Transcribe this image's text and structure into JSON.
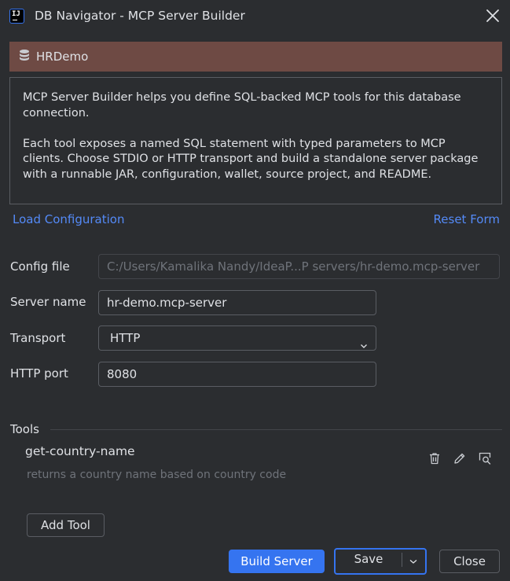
{
  "window": {
    "title": "DB Navigator - MCP Server Builder",
    "logo_text": "IJ"
  },
  "connection": {
    "name": "HRDemo",
    "color": "#6e4a44"
  },
  "description": {
    "para1": "MCP Server Builder helps you define SQL-backed MCP tools for this database connection.",
    "para2": "Each tool exposes a named SQL statement with typed parameters to MCP clients. Choose STDIO or HTTP transport and build a standalone server package with a runnable JAR, configuration, wallet, source project, and README."
  },
  "links": {
    "load": "Load Configuration",
    "reset": "Reset Form"
  },
  "form": {
    "config_file_label": "Config file",
    "config_file_value": "C:/Users/Kamalika Nandy/IdeaP...P servers/hr-demo.mcp-server",
    "server_name_label": "Server name",
    "server_name_value": "hr-demo.mcp-server",
    "transport_label": "Transport",
    "transport_value": "HTTP",
    "http_port_label": "HTTP port",
    "http_port_value": "8080"
  },
  "tools": {
    "section_label": "Tools",
    "items": [
      {
        "name": "get-country-name",
        "description": "returns a country name based on country code"
      }
    ],
    "add_label": "Add Tool"
  },
  "footer": {
    "build_label": "Build Server",
    "save_label": "Save",
    "close_label": "Close"
  },
  "colors": {
    "accent": "#3574f0",
    "link": "#548af7",
    "background": "#2b2d30"
  }
}
